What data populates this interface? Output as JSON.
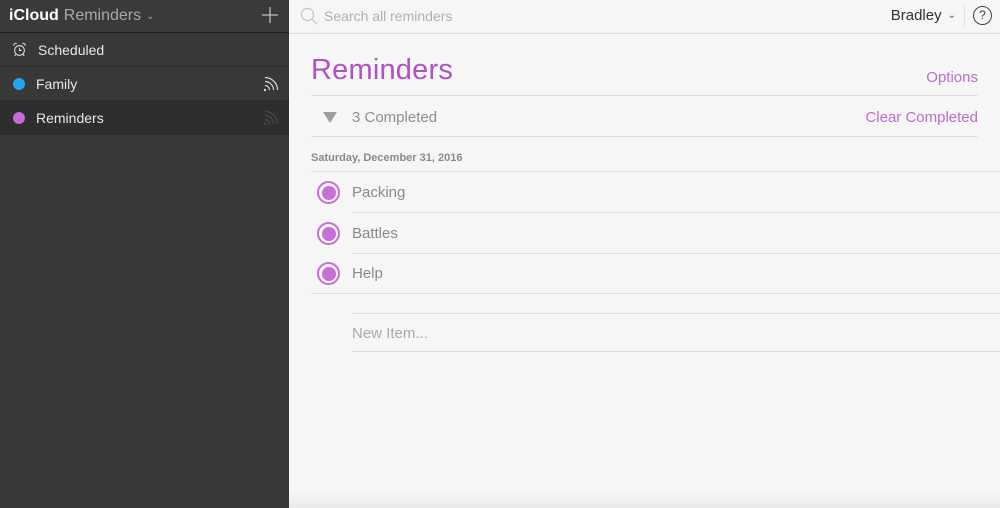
{
  "app": {
    "brand": "iCloud",
    "name": "Reminders"
  },
  "sidebar": {
    "items": [
      {
        "label": "Scheduled",
        "icon": "alarm-clock-icon"
      },
      {
        "label": "Family",
        "color": "#1fa6f3",
        "shared": true
      },
      {
        "label": "Reminders",
        "color": "#c56ad6",
        "shared": true,
        "selected": true
      }
    ]
  },
  "topbar": {
    "search_placeholder": "Search all reminders",
    "user_name": "Bradley",
    "help_label": "?"
  },
  "list": {
    "title": "Reminders",
    "options_label": "Options",
    "completed_count_label": "3 Completed",
    "clear_completed_label": "Clear Completed",
    "accent_color": "#b052c3",
    "date_header": "Saturday, December 31, 2016",
    "items": [
      {
        "title": "Packing",
        "completed": true
      },
      {
        "title": "Battles",
        "completed": true
      },
      {
        "title": "Help",
        "completed": true
      }
    ],
    "new_item_placeholder": "New Item..."
  }
}
